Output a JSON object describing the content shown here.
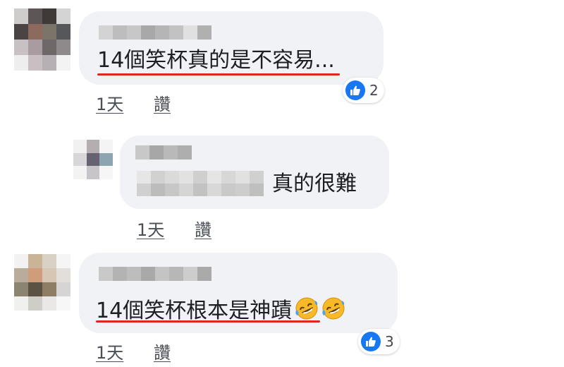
{
  "comments": [
    {
      "text": "14個笑杯真的是不容易...",
      "time": "1天",
      "like_label": "讚",
      "reaction_count": "2",
      "reaction_icon": "like-icon"
    },
    {
      "text": "真的很難",
      "time": "1天",
      "like_label": "讚"
    },
    {
      "text": "14個笑杯根本是神蹟",
      "emoji": [
        "rolling-on-floor-laughing-emoji",
        "rolling-on-floor-laughing-emoji"
      ],
      "time": "1天",
      "like_label": "讚",
      "reaction_count": "3",
      "reaction_icon": "like-icon"
    }
  ],
  "colors": {
    "bubble": "#f0f2f5",
    "highlight_underline": "#e0261d",
    "like_blue": "#1877f2",
    "meta_text": "#4b4f56"
  }
}
